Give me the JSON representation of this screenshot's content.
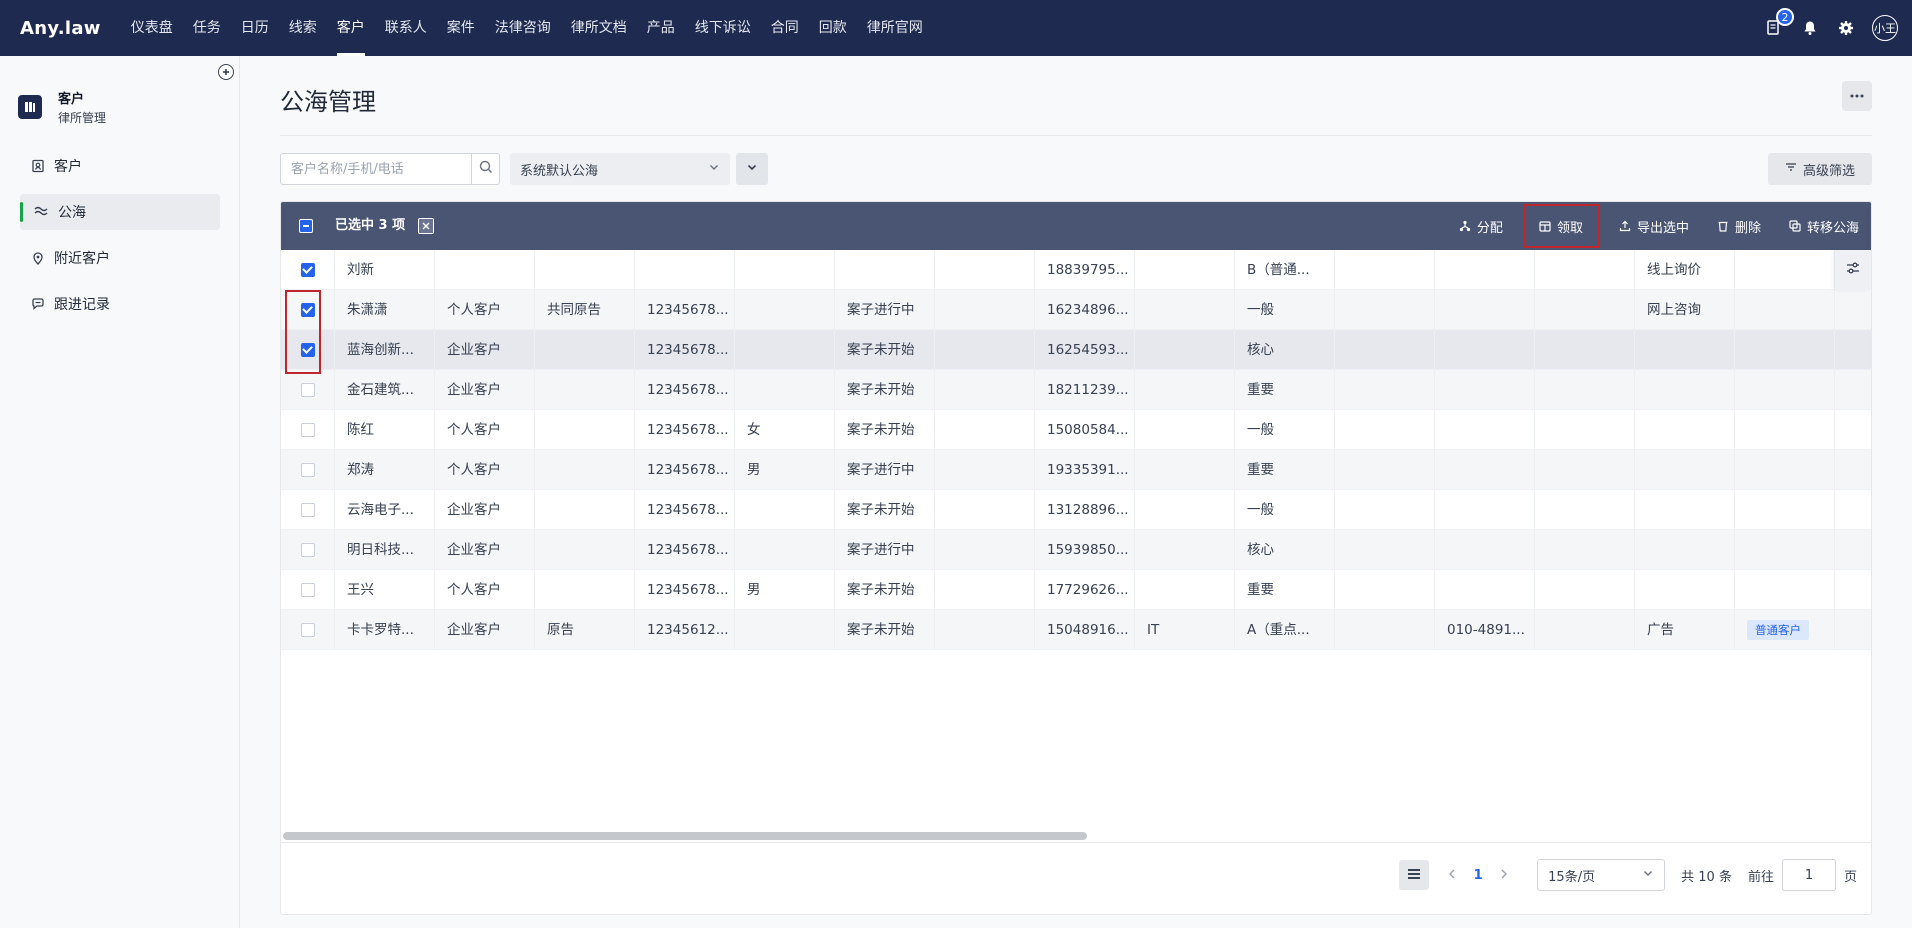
{
  "topnav": {
    "logo": "Any.law",
    "items": [
      "仪表盘",
      "任务",
      "日历",
      "线索",
      "客户",
      "联系人",
      "案件",
      "法律咨询",
      "律所文档",
      "产品",
      "线下诉讼",
      "合同",
      "回款",
      "律所官网"
    ],
    "active_index": 4,
    "badge_count": "2",
    "avatar_text": "小王"
  },
  "sidebar": {
    "module_title": "客户",
    "module_subtitle": "律所管理",
    "items": [
      {
        "label": "客户",
        "icon": "contacts-icon"
      },
      {
        "label": "公海",
        "icon": "waves-icon"
      },
      {
        "label": "附近客户",
        "icon": "location-pin-icon"
      },
      {
        "label": "跟进记录",
        "icon": "chat-icon"
      }
    ],
    "active_index": 1
  },
  "main": {
    "page_title": "公海管理",
    "search_placeholder": "客户名称/手机/电话",
    "sea_select_value": "系统默认公海",
    "advanced_filter_label": "高级筛选"
  },
  "bulk": {
    "selected_text": "已选中 3 项",
    "actions": [
      {
        "label": "分配",
        "icon": "assign-icon"
      },
      {
        "label": "领取",
        "icon": "claim-icon"
      },
      {
        "label": "导出选中",
        "icon": "export-icon"
      },
      {
        "label": "删除",
        "icon": "trash-icon"
      },
      {
        "label": "转移公海",
        "icon": "transfer-icon"
      }
    ],
    "highlight_index": 1
  },
  "table": {
    "rows": [
      {
        "checked": true,
        "cells": [
          "刘新",
          "",
          "",
          "",
          "",
          "",
          "",
          "18839795...",
          "",
          "B（普通...",
          "",
          "",
          "",
          "线上询价",
          ""
        ]
      },
      {
        "checked": true,
        "cells": [
          "朱潇潇",
          "个人客户",
          "共同原告",
          "12345678...",
          "",
          "案子进行中",
          "",
          "16234896...",
          "",
          "一般",
          "",
          "",
          "",
          "网上咨询",
          ""
        ]
      },
      {
        "checked": true,
        "cells": [
          "蓝海创新...",
          "企业客户",
          "",
          "12345678...",
          "",
          "案子未开始",
          "",
          "16254593...",
          "",
          "核心",
          "",
          "",
          "",
          "",
          ""
        ]
      },
      {
        "checked": false,
        "cells": [
          "金石建筑...",
          "企业客户",
          "",
          "12345678...",
          "",
          "案子未开始",
          "",
          "18211239...",
          "",
          "重要",
          "",
          "",
          "",
          "",
          ""
        ]
      },
      {
        "checked": false,
        "cells": [
          "陈红",
          "个人客户",
          "",
          "12345678...",
          "女",
          "案子未开始",
          "",
          "15080584...",
          "",
          "一般",
          "",
          "",
          "",
          "",
          ""
        ]
      },
      {
        "checked": false,
        "cells": [
          "郑涛",
          "个人客户",
          "",
          "12345678...",
          "男",
          "案子进行中",
          "",
          "19335391...",
          "",
          "重要",
          "",
          "",
          "",
          "",
          ""
        ]
      },
      {
        "checked": false,
        "cells": [
          "云海电子...",
          "企业客户",
          "",
          "12345678...",
          "",
          "案子未开始",
          "",
          "13128896...",
          "",
          "一般",
          "",
          "",
          "",
          "",
          ""
        ]
      },
      {
        "checked": false,
        "cells": [
          "明日科技...",
          "企业客户",
          "",
          "12345678...",
          "",
          "案子进行中",
          "",
          "15939850...",
          "",
          "核心",
          "",
          "",
          "",
          "",
          ""
        ]
      },
      {
        "checked": false,
        "cells": [
          "王兴",
          "个人客户",
          "",
          "12345678...",
          "男",
          "案子未开始",
          "",
          "17729626...",
          "",
          "重要",
          "",
          "",
          "",
          "",
          ""
        ]
      },
      {
        "checked": false,
        "cells": [
          "卡卡罗特...",
          "企业客户",
          "原告",
          "12345612...",
          "",
          "案子未开始",
          "",
          "15048916...",
          "IT",
          "A（重点...",
          "",
          "010-4891...",
          "",
          "广告",
          ""
        ],
        "tag": "普通客户"
      }
    ]
  },
  "pager": {
    "current_page": "1",
    "page_size": "15条/页",
    "total_text": "共 10 条",
    "goto_label": "前往",
    "goto_value": "1",
    "page_unit": "页"
  }
}
